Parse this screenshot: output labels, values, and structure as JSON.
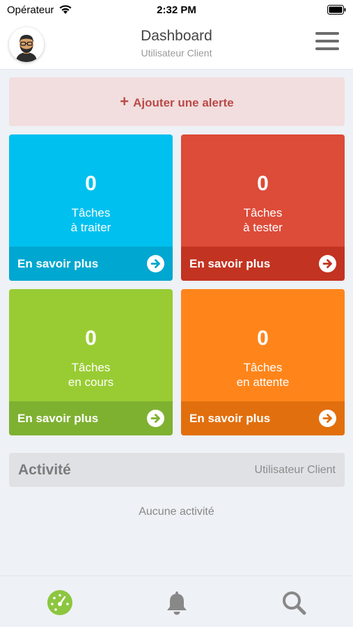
{
  "status_bar": {
    "carrier": "Opérateur",
    "time": "2:32 PM"
  },
  "header": {
    "title": "Dashboard",
    "subtitle": "Utilisateur Client"
  },
  "alert_button": {
    "plus": "+",
    "label": "Ajouter une alerte"
  },
  "tiles": [
    {
      "count": "0",
      "line1": "Tâches",
      "line2": "à traiter",
      "more": "En savoir plus",
      "color": "#00c0ef"
    },
    {
      "count": "0",
      "line1": "Tâches",
      "line2": "à tester",
      "more": "En savoir plus",
      "color": "#dd4b39"
    },
    {
      "count": "0",
      "line1": "Tâches",
      "line2": "en cours",
      "more": "En savoir plus",
      "color": "#99cc33"
    },
    {
      "count": "0",
      "line1": "Tâches",
      "line2": "en attente",
      "more": "En savoir plus",
      "color": "#ff851b"
    }
  ],
  "activity": {
    "title": "Activité",
    "user": "Utilisateur Client",
    "empty": "Aucune activité"
  },
  "tabbar": {
    "items": [
      {
        "icon": "dashboard-icon",
        "active": true,
        "color": "#8cc63f"
      },
      {
        "icon": "bell-icon",
        "active": false,
        "color": "#888888"
      },
      {
        "icon": "search-icon",
        "active": false,
        "color": "#888888"
      }
    ]
  }
}
